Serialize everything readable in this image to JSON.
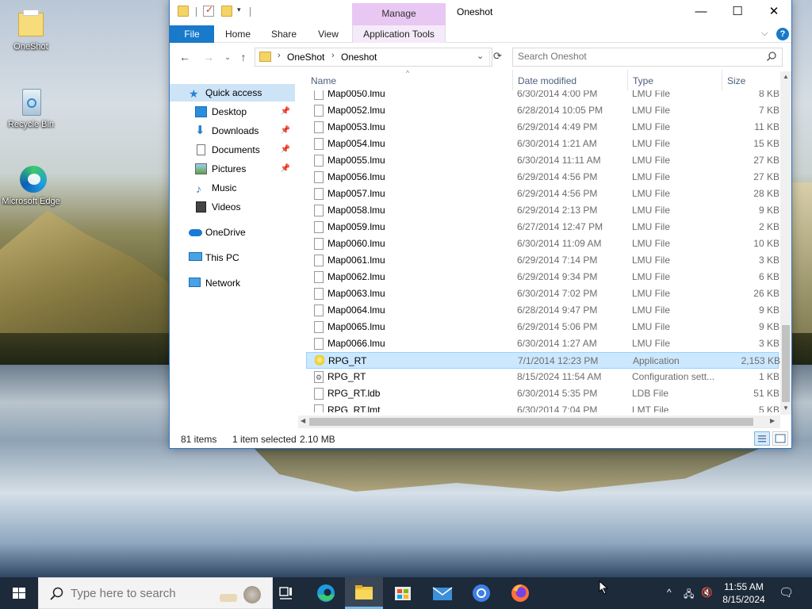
{
  "desktop": {
    "icons": [
      {
        "label": "OneShot"
      },
      {
        "label": "Recycle Bin"
      },
      {
        "label": "Microsoft Edge"
      }
    ]
  },
  "window": {
    "title": "Oneshot",
    "manage_label": "Manage",
    "accent": "#1979ca"
  },
  "ribbon": {
    "tabs": [
      "File",
      "Home",
      "Share",
      "View",
      "Application Tools"
    ]
  },
  "address": {
    "crumbs": [
      "OneShot",
      "Oneshot"
    ],
    "search_placeholder": "Search Oneshot"
  },
  "navpane": {
    "items": [
      {
        "label": "Quick access",
        "icon": "star-icon"
      },
      {
        "label": "Desktop",
        "icon": "desktop-icon"
      },
      {
        "label": "Downloads",
        "icon": "download-icon"
      },
      {
        "label": "Documents",
        "icon": "document-icon"
      },
      {
        "label": "Pictures",
        "icon": "picture-icon"
      },
      {
        "label": "Music",
        "icon": "music-icon"
      },
      {
        "label": "Videos",
        "icon": "video-icon"
      },
      {
        "label": "OneDrive",
        "icon": "cloud-icon"
      },
      {
        "label": "This PC",
        "icon": "computer-icon"
      },
      {
        "label": "Network",
        "icon": "network-icon"
      }
    ]
  },
  "columns": {
    "name": "Name",
    "date": "Date modified",
    "type": "Type",
    "size": "Size"
  },
  "files": [
    {
      "name": "Map0050.lmu",
      "date": "6/30/2014 4:00 PM",
      "type": "LMU File",
      "size": "8 KB"
    },
    {
      "name": "Map0052.lmu",
      "date": "6/28/2014 10:05 PM",
      "type": "LMU File",
      "size": "7 KB"
    },
    {
      "name": "Map0053.lmu",
      "date": "6/29/2014 4:49 PM",
      "type": "LMU File",
      "size": "11 KB"
    },
    {
      "name": "Map0054.lmu",
      "date": "6/30/2014 1:21 AM",
      "type": "LMU File",
      "size": "15 KB"
    },
    {
      "name": "Map0055.lmu",
      "date": "6/30/2014 11:11 AM",
      "type": "LMU File",
      "size": "27 KB"
    },
    {
      "name": "Map0056.lmu",
      "date": "6/29/2014 4:56 PM",
      "type": "LMU File",
      "size": "27 KB"
    },
    {
      "name": "Map0057.lmu",
      "date": "6/29/2014 4:56 PM",
      "type": "LMU File",
      "size": "28 KB"
    },
    {
      "name": "Map0058.lmu",
      "date": "6/29/2014 2:13 PM",
      "type": "LMU File",
      "size": "9 KB"
    },
    {
      "name": "Map0059.lmu",
      "date": "6/27/2014 12:47 PM",
      "type": "LMU File",
      "size": "2 KB"
    },
    {
      "name": "Map0060.lmu",
      "date": "6/30/2014 11:09 AM",
      "type": "LMU File",
      "size": "10 KB"
    },
    {
      "name": "Map0061.lmu",
      "date": "6/29/2014 7:14 PM",
      "type": "LMU File",
      "size": "3 KB"
    },
    {
      "name": "Map0062.lmu",
      "date": "6/29/2014 9:34 PM",
      "type": "LMU File",
      "size": "6 KB"
    },
    {
      "name": "Map0063.lmu",
      "date": "6/30/2014 7:02 PM",
      "type": "LMU File",
      "size": "26 KB"
    },
    {
      "name": "Map0064.lmu",
      "date": "6/28/2014 9:47 PM",
      "type": "LMU File",
      "size": "9 KB"
    },
    {
      "name": "Map0065.lmu",
      "date": "6/29/2014 5:06 PM",
      "type": "LMU File",
      "size": "9 KB"
    },
    {
      "name": "Map0066.lmu",
      "date": "6/30/2014 1:27 AM",
      "type": "LMU File",
      "size": "3 KB"
    },
    {
      "name": "RPG_RT",
      "date": "7/1/2014 12:23 PM",
      "type": "Application",
      "size": "2,153 KB",
      "selected": true
    },
    {
      "name": "RPG_RT",
      "date": "8/15/2024 11:54 AM",
      "type": "Configuration sett...",
      "size": "1 KB"
    },
    {
      "name": "RPG_RT.ldb",
      "date": "6/30/2014 5:35 PM",
      "type": "LDB File",
      "size": "51 KB"
    },
    {
      "name": "RPG_RT.lmt",
      "date": "6/30/2014 7:04 PM",
      "type": "LMT File",
      "size": "5 KB"
    }
  ],
  "status": {
    "count": "81 items",
    "selected": "1 item selected",
    "size": "2.10 MB"
  },
  "taskbar": {
    "search_placeholder": "Type here to search",
    "time": "11:55 AM",
    "date": "8/15/2024"
  }
}
